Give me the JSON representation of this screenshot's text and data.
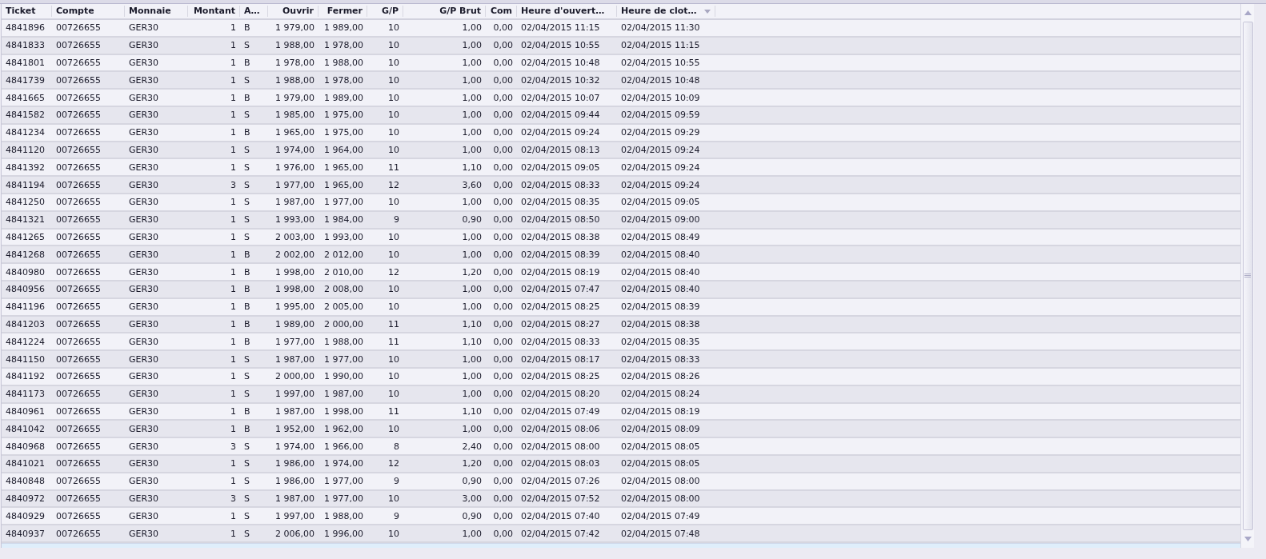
{
  "table": {
    "columns": [
      "Ticket",
      "Compte",
      "Monnaie",
      "Montant",
      "A…",
      "Ouvrir",
      "Fermer",
      "G/P",
      "G/P Brut",
      "Com",
      "Heure d'ouvert…",
      "Heure de clot…"
    ],
    "rows": [
      [
        "4841896",
        "00726655",
        "GER30",
        "1",
        "B",
        "1 979,00",
        "1 989,00",
        "10",
        "1,00",
        "0,00",
        "02/04/2015 11:15",
        "02/04/2015 11:30"
      ],
      [
        "4841833",
        "00726655",
        "GER30",
        "1",
        "S",
        "1 988,00",
        "1 978,00",
        "10",
        "1,00",
        "0,00",
        "02/04/2015 10:55",
        "02/04/2015 11:15"
      ],
      [
        "4841801",
        "00726655",
        "GER30",
        "1",
        "B",
        "1 978,00",
        "1 988,00",
        "10",
        "1,00",
        "0,00",
        "02/04/2015 10:48",
        "02/04/2015 10:55"
      ],
      [
        "4841739",
        "00726655",
        "GER30",
        "1",
        "S",
        "1 988,00",
        "1 978,00",
        "10",
        "1,00",
        "0,00",
        "02/04/2015 10:32",
        "02/04/2015 10:48"
      ],
      [
        "4841665",
        "00726655",
        "GER30",
        "1",
        "B",
        "1 979,00",
        "1 989,00",
        "10",
        "1,00",
        "0,00",
        "02/04/2015 10:07",
        "02/04/2015 10:09"
      ],
      [
        "4841582",
        "00726655",
        "GER30",
        "1",
        "S",
        "1 985,00",
        "1 975,00",
        "10",
        "1,00",
        "0,00",
        "02/04/2015 09:44",
        "02/04/2015 09:59"
      ],
      [
        "4841234",
        "00726655",
        "GER30",
        "1",
        "B",
        "1 965,00",
        "1 975,00",
        "10",
        "1,00",
        "0,00",
        "02/04/2015 09:24",
        "02/04/2015 09:29"
      ],
      [
        "4841120",
        "00726655",
        "GER30",
        "1",
        "S",
        "1 974,00",
        "1 964,00",
        "10",
        "1,00",
        "0,00",
        "02/04/2015 08:13",
        "02/04/2015 09:24"
      ],
      [
        "4841392",
        "00726655",
        "GER30",
        "1",
        "S",
        "1 976,00",
        "1 965,00",
        "11",
        "1,10",
        "0,00",
        "02/04/2015 09:05",
        "02/04/2015 09:24"
      ],
      [
        "4841194",
        "00726655",
        "GER30",
        "3",
        "S",
        "1 977,00",
        "1 965,00",
        "12",
        "3,60",
        "0,00",
        "02/04/2015 08:33",
        "02/04/2015 09:24"
      ],
      [
        "4841250",
        "00726655",
        "GER30",
        "1",
        "S",
        "1 987,00",
        "1 977,00",
        "10",
        "1,00",
        "0,00",
        "02/04/2015 08:35",
        "02/04/2015 09:05"
      ],
      [
        "4841321",
        "00726655",
        "GER30",
        "1",
        "S",
        "1 993,00",
        "1 984,00",
        "9",
        "0,90",
        "0,00",
        "02/04/2015 08:50",
        "02/04/2015 09:00"
      ],
      [
        "4841265",
        "00726655",
        "GER30",
        "1",
        "S",
        "2 003,00",
        "1 993,00",
        "10",
        "1,00",
        "0,00",
        "02/04/2015 08:38",
        "02/04/2015 08:49"
      ],
      [
        "4841268",
        "00726655",
        "GER30",
        "1",
        "B",
        "2 002,00",
        "2 012,00",
        "10",
        "1,00",
        "0,00",
        "02/04/2015 08:39",
        "02/04/2015 08:40"
      ],
      [
        "4840980",
        "00726655",
        "GER30",
        "1",
        "B",
        "1 998,00",
        "2 010,00",
        "12",
        "1,20",
        "0,00",
        "02/04/2015 08:19",
        "02/04/2015 08:40"
      ],
      [
        "4840956",
        "00726655",
        "GER30",
        "1",
        "B",
        "1 998,00",
        "2 008,00",
        "10",
        "1,00",
        "0,00",
        "02/04/2015 07:47",
        "02/04/2015 08:40"
      ],
      [
        "4841196",
        "00726655",
        "GER30",
        "1",
        "B",
        "1 995,00",
        "2 005,00",
        "10",
        "1,00",
        "0,00",
        "02/04/2015 08:25",
        "02/04/2015 08:39"
      ],
      [
        "4841203",
        "00726655",
        "GER30",
        "1",
        "B",
        "1 989,00",
        "2 000,00",
        "11",
        "1,10",
        "0,00",
        "02/04/2015 08:27",
        "02/04/2015 08:38"
      ],
      [
        "4841224",
        "00726655",
        "GER30",
        "1",
        "B",
        "1 977,00",
        "1 988,00",
        "11",
        "1,10",
        "0,00",
        "02/04/2015 08:33",
        "02/04/2015 08:35"
      ],
      [
        "4841150",
        "00726655",
        "GER30",
        "1",
        "S",
        "1 987,00",
        "1 977,00",
        "10",
        "1,00",
        "0,00",
        "02/04/2015 08:17",
        "02/04/2015 08:33"
      ],
      [
        "4841192",
        "00726655",
        "GER30",
        "1",
        "S",
        "2 000,00",
        "1 990,00",
        "10",
        "1,00",
        "0,00",
        "02/04/2015 08:25",
        "02/04/2015 08:26"
      ],
      [
        "4841173",
        "00726655",
        "GER30",
        "1",
        "S",
        "1 997,00",
        "1 987,00",
        "10",
        "1,00",
        "0,00",
        "02/04/2015 08:20",
        "02/04/2015 08:24"
      ],
      [
        "4840961",
        "00726655",
        "GER30",
        "1",
        "B",
        "1 987,00",
        "1 998,00",
        "11",
        "1,10",
        "0,00",
        "02/04/2015 07:49",
        "02/04/2015 08:19"
      ],
      [
        "4841042",
        "00726655",
        "GER30",
        "1",
        "B",
        "1 952,00",
        "1 962,00",
        "10",
        "1,00",
        "0,00",
        "02/04/2015 08:06",
        "02/04/2015 08:09"
      ],
      [
        "4840968",
        "00726655",
        "GER30",
        "3",
        "S",
        "1 974,00",
        "1 966,00",
        "8",
        "2,40",
        "0,00",
        "02/04/2015 08:00",
        "02/04/2015 08:05"
      ],
      [
        "4841021",
        "00726655",
        "GER30",
        "1",
        "S",
        "1 986,00",
        "1 974,00",
        "12",
        "1,20",
        "0,00",
        "02/04/2015 08:03",
        "02/04/2015 08:05"
      ],
      [
        "4840848",
        "00726655",
        "GER30",
        "1",
        "S",
        "1 986,00",
        "1 977,00",
        "9",
        "0,90",
        "0,00",
        "02/04/2015 07:26",
        "02/04/2015 08:00"
      ],
      [
        "4840972",
        "00726655",
        "GER30",
        "3",
        "S",
        "1 987,00",
        "1 977,00",
        "10",
        "3,00",
        "0,00",
        "02/04/2015 07:52",
        "02/04/2015 08:00"
      ],
      [
        "4840929",
        "00726655",
        "GER30",
        "1",
        "S",
        "1 997,00",
        "1 988,00",
        "9",
        "0,90",
        "0,00",
        "02/04/2015 07:40",
        "02/04/2015 07:49"
      ],
      [
        "4840937",
        "00726655",
        "GER30",
        "1",
        "S",
        "2 006,00",
        "1 996,00",
        "10",
        "1,00",
        "0,00",
        "02/04/2015 07:42",
        "02/04/2015 07:48"
      ]
    ]
  }
}
